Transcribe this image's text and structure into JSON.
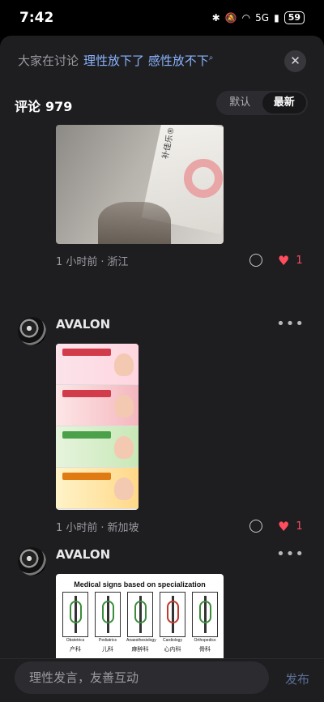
{
  "status_bar": {
    "time": "7:42",
    "network": "5G",
    "battery": "59"
  },
  "topic": {
    "lead": "大家在讨论",
    "link": "理性放下了 感性放不下",
    "link_icon": "search-icon"
  },
  "comments_header": {
    "label": "评论",
    "count": "979",
    "sort_options": [
      "默认",
      "最新"
    ],
    "active_sort": "最新"
  },
  "comments": [
    {
      "time": "1 小时前",
      "location": "浙江",
      "likes": "1",
      "image_text": "补佳乐® PROGYNOVA® 戊酸雌二醇片"
    },
    {
      "user": "AVALON",
      "time": "1 小时前",
      "location": "新加坡",
      "likes": "1"
    },
    {
      "user": "AVALON",
      "image_title": "Medical signs based on specialization",
      "specialties": [
        "Obstetrics",
        "Pediatrics",
        "Anaesthesiology",
        "Cardiology",
        "Orthopedics"
      ],
      "specialties_cn": [
        "产科",
        "儿科",
        "麻醉科",
        "心内科",
        "骨科"
      ]
    }
  ],
  "input": {
    "placeholder": "理性发言，友善互动",
    "publish_label": "发布"
  },
  "colors": {
    "accent_link": "#8ab4ff",
    "like": "#ff4d5e",
    "sheet_bg": "#1e1e21"
  }
}
